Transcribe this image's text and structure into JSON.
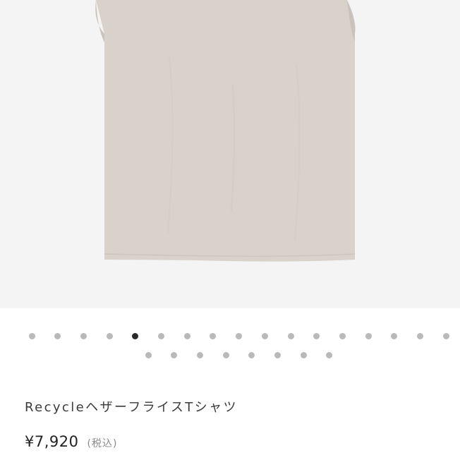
{
  "product": {
    "image_alt": "sleeveless knit t-shirt, heather beige",
    "image_color": "#d8d2cb",
    "title": "RecycleヘザーフライスTシャツ",
    "price": "¥7,920",
    "tax_note": "(税込)"
  },
  "carousel": {
    "total": 25,
    "active_index": 4,
    "dot_color": "#b9b9b9",
    "active_color": "#2b2b2b"
  }
}
